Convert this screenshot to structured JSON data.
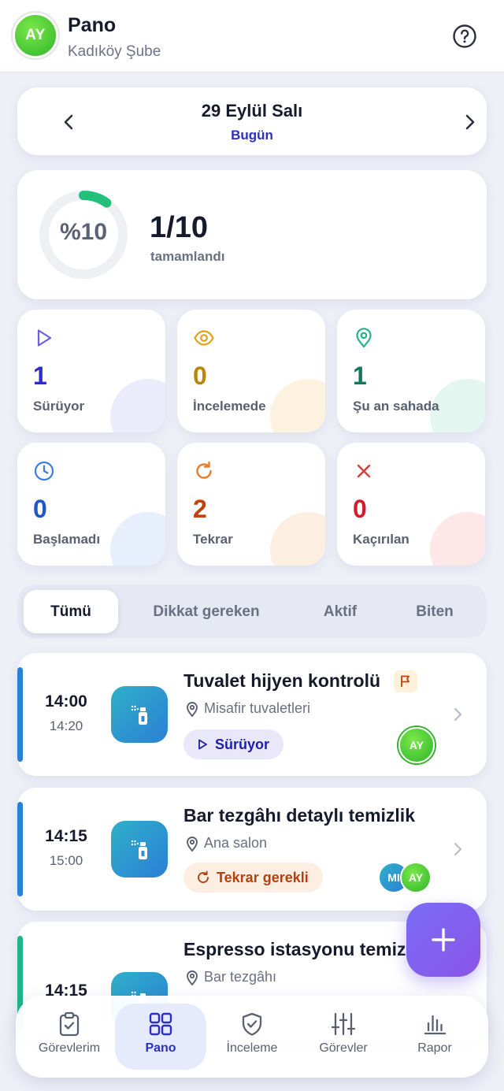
{
  "header": {
    "avatar_initials": "AY",
    "title": "Pano",
    "subtitle": "Kadıköy Şube",
    "help_icon": "help-circle-icon"
  },
  "date_nav": {
    "date": "29 Eylül Salı",
    "relative": "Bugün"
  },
  "progress": {
    "percent_label": "%10",
    "fraction": 0.1,
    "count": "1/10",
    "label": "tamamlandı",
    "accent_color": "#22c07a"
  },
  "stats": [
    {
      "value": "1",
      "label": "Sürüyor",
      "icon": "play-icon",
      "color": "#2b2fc5",
      "icon_color": "#6c5ce7",
      "blob": "#ecebfb"
    },
    {
      "value": "0",
      "label": "İncelemede",
      "icon": "eye-icon",
      "color": "#b8860b",
      "icon_color": "#e0a21a",
      "blob": "#fdf1df"
    },
    {
      "value": "1",
      "label": "Şu an sahada",
      "icon": "map-pin-icon",
      "color": "#127a5a",
      "icon_color": "#1fb58a",
      "blob": "#e3f6ef"
    },
    {
      "value": "0",
      "label": "Başlamadı",
      "icon": "clock-icon",
      "color": "#1f57c4",
      "icon_color": "#3b7be0",
      "blob": "#e7effc"
    },
    {
      "value": "2",
      "label": "Tekrar",
      "icon": "refresh-icon",
      "color": "#c2410c",
      "icon_color": "#ec7a2a",
      "blob": "#fdeee2"
    },
    {
      "value": "0",
      "label": "Kaçırılan",
      "icon": "x-icon",
      "color": "#d11f2a",
      "icon_color": "#e23a3a",
      "blob": "#fde7e7"
    }
  ],
  "tabs": [
    {
      "label": "Tümü",
      "active": true
    },
    {
      "label": "Dikkat gereken",
      "active": false
    },
    {
      "label": "Aktif",
      "active": false
    },
    {
      "label": "Biten",
      "active": false
    }
  ],
  "tasks": [
    {
      "start": "14:00",
      "end": "14:20",
      "title": "Tuvalet hijyen kontrolü",
      "location": "Misafir tuvaletleri",
      "status": "Sürüyor",
      "status_icon": "play-icon",
      "flagged": true,
      "assignees": [
        "AY"
      ],
      "accent_color": "#2a7fd6"
    },
    {
      "start": "14:15",
      "end": "15:00",
      "title": "Bar tezgâhı detaylı temizlik",
      "location": "Ana salon",
      "status": "Tekrar gerekli",
      "status_icon": "refresh-icon",
      "flagged": false,
      "assignees": [
        "MI",
        "AY"
      ],
      "accent_color": "#2a7fd6"
    },
    {
      "start": "14:15",
      "end": "",
      "title": "Espresso istasyonu temizliği",
      "location": "Bar tezgâhı",
      "status": "",
      "flagged": false,
      "assignees": [],
      "accent_color": "#1fb58a"
    }
  ],
  "fab": {
    "icon": "plus-icon"
  },
  "bottom_nav": [
    {
      "label": "Görevlerim",
      "icon": "clipboard-check-icon",
      "active": false
    },
    {
      "label": "Pano",
      "icon": "grid-icon",
      "active": true
    },
    {
      "label": "İnceleme",
      "icon": "shield-check-icon",
      "active": false
    },
    {
      "label": "Görevler",
      "icon": "sliders-icon",
      "active": false
    },
    {
      "label": "Rapor",
      "icon": "bar-chart-icon",
      "active": false
    }
  ]
}
